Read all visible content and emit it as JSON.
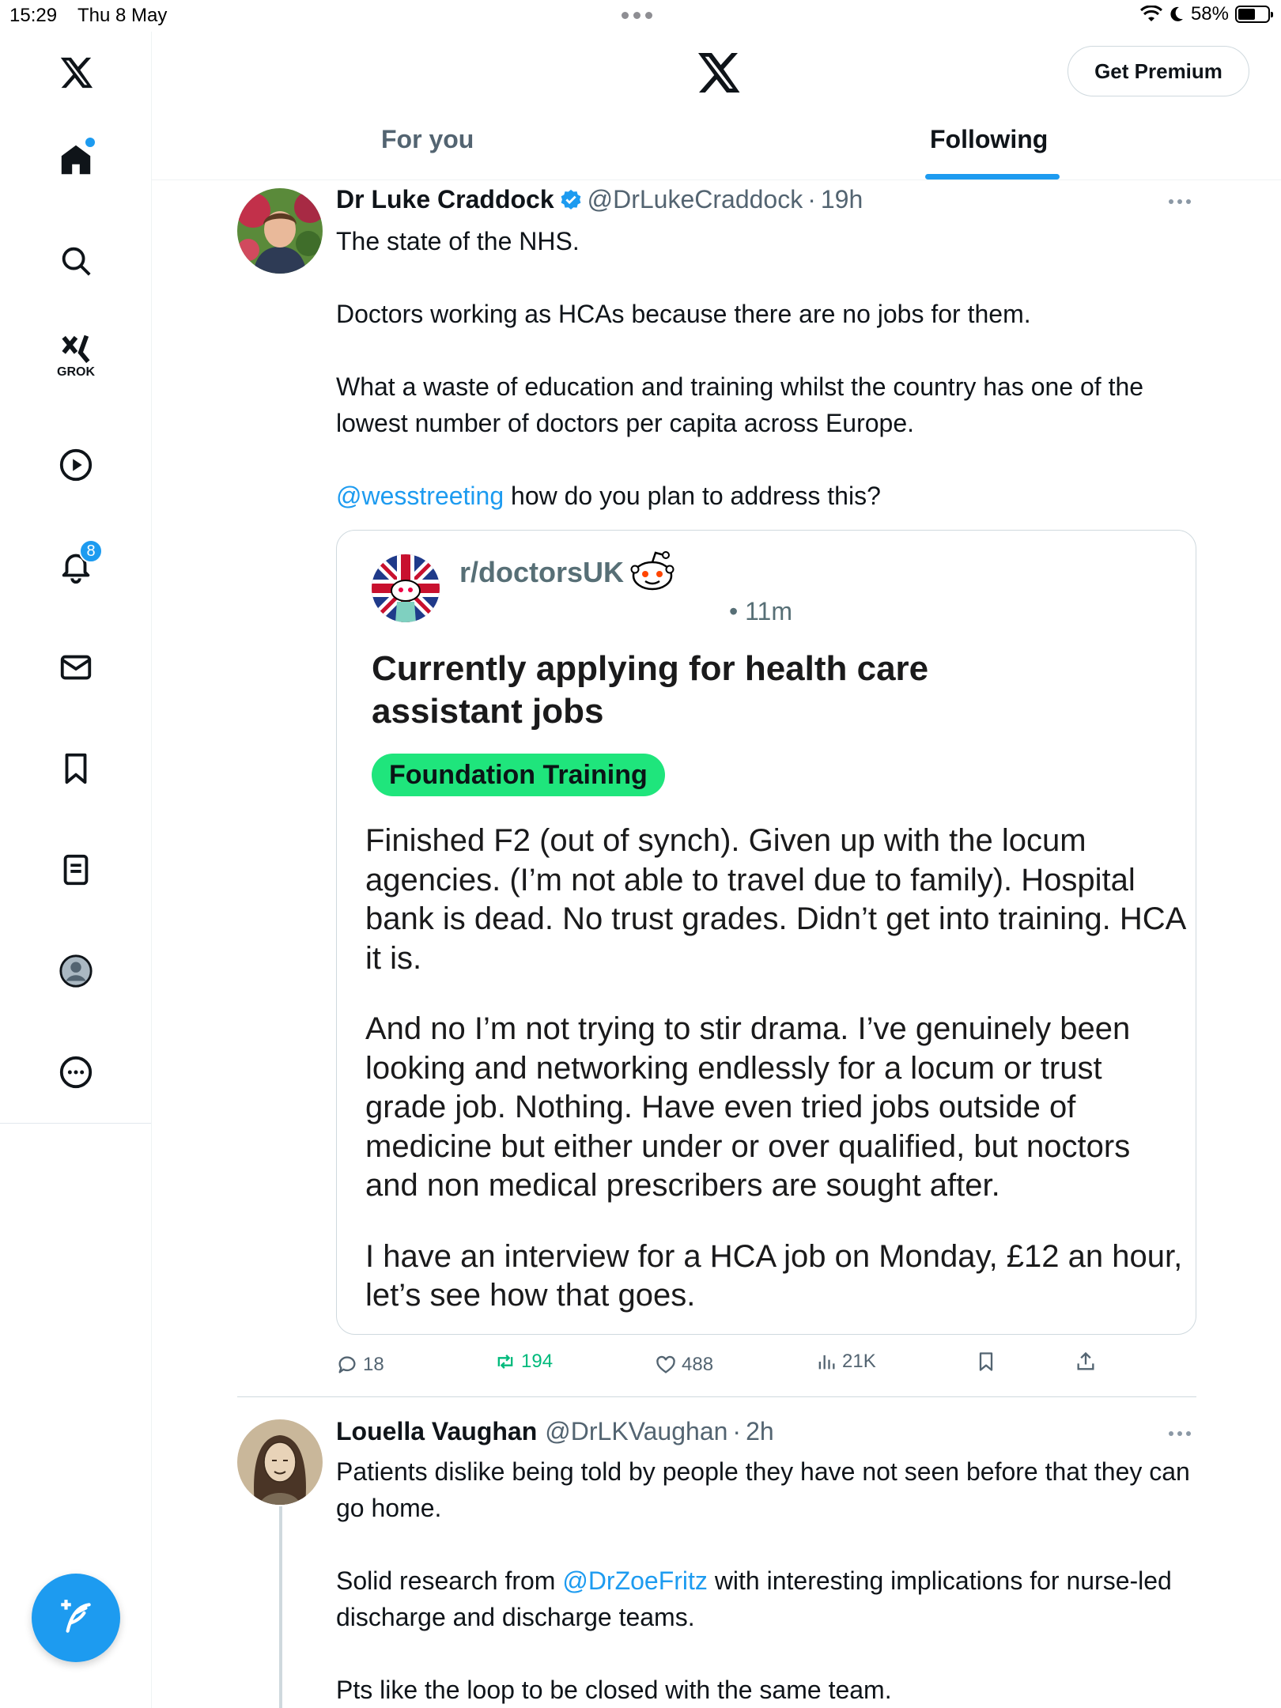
{
  "status_bar": {
    "time": "15:29",
    "date": "Thu 8 May",
    "battery": "58%",
    "battery_level": 0.58
  },
  "sidebar": {
    "grok_label": "GROK",
    "notification_count": "8",
    "icons": [
      "x-logo-icon",
      "home-icon",
      "search-icon",
      "grok-icon",
      "video-icon",
      "bell-icon",
      "mail-icon",
      "bookmark-icon",
      "list-icon",
      "profile-icon",
      "more-icon",
      "compose-icon"
    ]
  },
  "header": {
    "premium_label": "Get Premium",
    "tabs": [
      {
        "label": "For you",
        "active": false
      },
      {
        "label": "Following",
        "active": true
      }
    ]
  },
  "tweets": [
    {
      "name": "Dr Luke Craddock",
      "verified": true,
      "handle": "@DrLukeCraddock",
      "time": "19h",
      "paragraphs": [
        "The state of the NHS.",
        "Doctors working as HCAs because there are no jobs for them.",
        "What a waste of education and training whilst the country has one of the lowest number of doctors per capita across Europe."
      ],
      "mention": "@wesstreeting",
      "mention_tail": " how do you plan to address this?",
      "embed": {
        "subreddit": "r/doctorsUK",
        "time": "11m",
        "title": "Currently applying for health care assistant jobs",
        "flair": "Foundation Training",
        "paragraphs": [
          "Finished F2 (out of synch). Given up with the locum agencies. (I’m not able to travel due to family). Hospital bank is dead. No trust grades. Didn’t get into training. HCA it is.",
          "And no I’m not trying to stir drama. I’ve genuinely been looking and networking endlessly for a locum or trust grade job. Nothing. Have even tried jobs outside of medicine but either under or over qualified, but noctors and non medical prescribers are sought after.",
          "I have an interview for a HCA job on Monday, £12 an hour, let’s see how that goes."
        ]
      },
      "stats": {
        "replies": "18",
        "reposts": "194",
        "likes": "488",
        "views": "21K"
      }
    },
    {
      "name": "Louella Vaughan",
      "handle": "@DrLKVaughan",
      "time": "2h",
      "p1": "Patients dislike being told by people they have not seen before that they can go home.",
      "p2_pre": "Solid research from ",
      "p2_mention": "@DrZoeFritz",
      "p2_post": " with interesting implications for nurse-led discharge and discharge teams.",
      "p3": "Pts like the loop to be closed with the same team."
    }
  ],
  "colors": {
    "accent": "#1d9bf0",
    "repost": "#00ba7c",
    "flair": "#1fe57c",
    "muted": "#536471"
  }
}
